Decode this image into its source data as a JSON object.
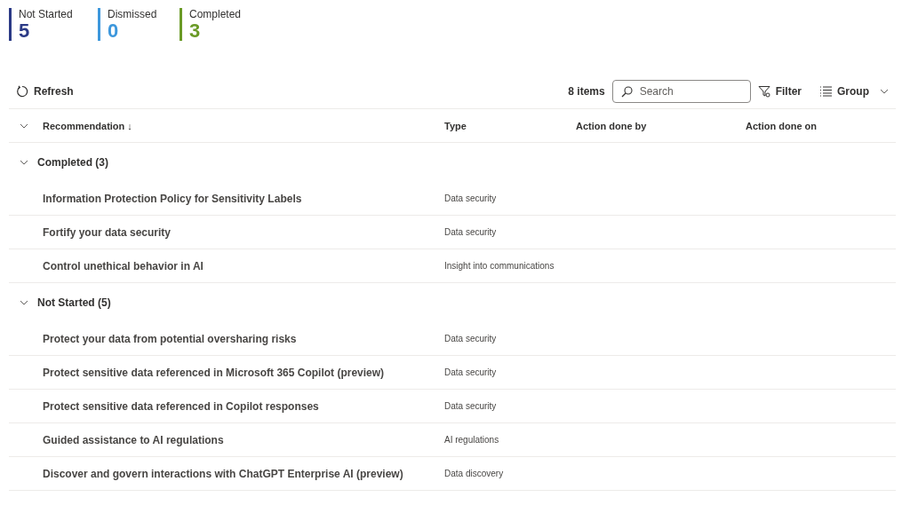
{
  "stats": [
    {
      "label": "Not Started",
      "value": "5",
      "color": "#2b3a86"
    },
    {
      "label": "Dismissed",
      "value": "0",
      "color": "#3d97dc"
    },
    {
      "label": "Completed",
      "value": "3",
      "color": "#6a9a26"
    }
  ],
  "toolbar": {
    "refresh": "Refresh",
    "count": "8 items",
    "search": {
      "placeholder": "Search"
    },
    "filter": "Filter",
    "group": "Group"
  },
  "table": {
    "columns": [
      {
        "label": "Recommendation ↓"
      },
      {
        "label": "Type"
      },
      {
        "label": "Action done by"
      },
      {
        "label": "Action done on"
      }
    ],
    "groups": [
      {
        "label": "Completed (3)",
        "expanded": true,
        "rows": [
          {
            "recommendation": "Information Protection Policy for Sensitivity Labels",
            "type": "Data security"
          },
          {
            "recommendation": "Fortify your data security",
            "type": "Data security"
          },
          {
            "recommendation": "Control unethical behavior in AI",
            "type": "Insight into communications"
          }
        ]
      },
      {
        "label": "Not Started (5)",
        "expanded": true,
        "rows": [
          {
            "recommendation": "Protect your data from potential oversharing risks",
            "type": "Data security"
          },
          {
            "recommendation": "Protect sensitive data referenced in Microsoft 365 Copilot (preview)",
            "type": "Data security"
          },
          {
            "recommendation": "Protect sensitive data referenced in Copilot responses",
            "type": "Data security"
          },
          {
            "recommendation": "Guided assistance to AI regulations",
            "type": "AI regulations"
          },
          {
            "recommendation": "Discover and govern interactions with ChatGPT Enterprise AI (preview)",
            "type": "Data discovery"
          }
        ]
      }
    ]
  }
}
